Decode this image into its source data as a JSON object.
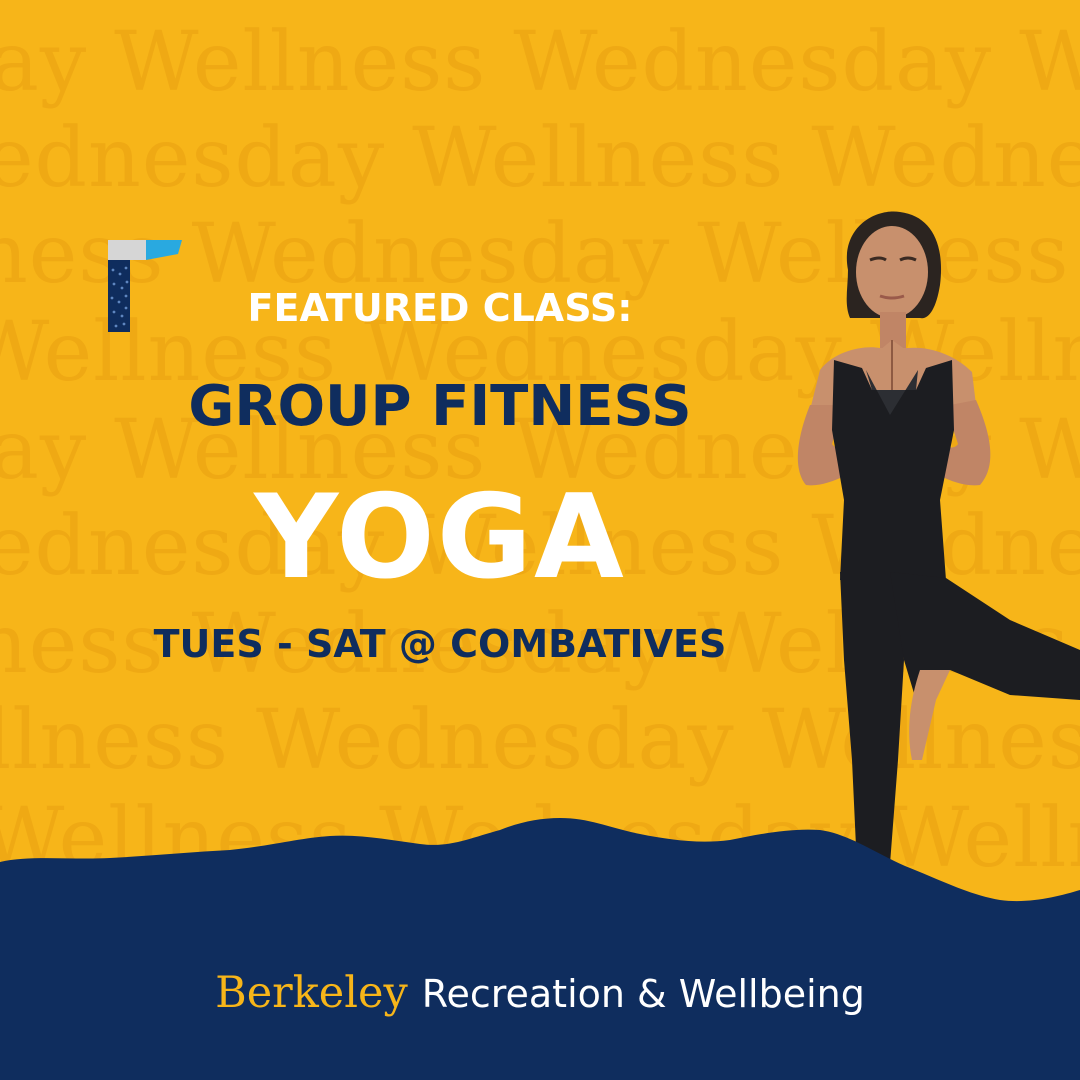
{
  "eyebrow": "FEATURED CLASS:",
  "program": "GROUP FITNESS",
  "class_name": "YOGA",
  "schedule": "TUES - SAT @ COMBATIVES",
  "watermark": {
    "lines": [
      "ay Wellness Wednesday Wellness",
      "ednesday Wellness Wednesday W",
      "ness Wednesday Wellness Wedne",
      "Wellness Wednesday Wellness We",
      "ay Wellness Wednesday Wellness",
      "ednesday Wellness Wednesday W",
      "ness Wednesday Wellness Wedne",
      "llness Wednesday Wellness Wed",
      "Wellness Wednesday Wellness W"
    ]
  },
  "footer": {
    "berkeley": "Berkeley",
    "department": "Recreation & Wellbeing"
  },
  "colors": {
    "background": "#f7b519",
    "navy": "#0f2d5e",
    "watermark": "#efa914",
    "white": "#ffffff",
    "accent_blue": "#29a9e0"
  },
  "icons": {
    "logo_mark": "flag-logo-icon",
    "photo": "yoga-woman-tree-pose"
  }
}
